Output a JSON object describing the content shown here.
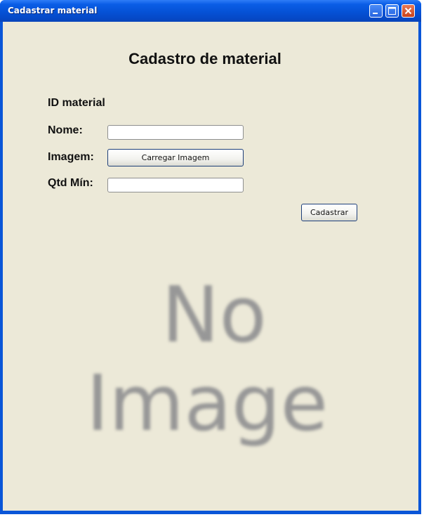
{
  "window": {
    "title": "Cadastrar material",
    "controls": {
      "minimize": "minimize-icon",
      "maximize": "maximize-icon",
      "close": "close-icon"
    }
  },
  "form": {
    "heading": "Cadastro de material",
    "id_label": "ID material",
    "name_label": "Nome:",
    "name_value": "",
    "image_label": "Imagem:",
    "load_image_button": "Carregar Imagem",
    "qty_label": "Qtd Mín:",
    "qty_value": "",
    "submit_button": "Cadastrar"
  },
  "image_placeholder": {
    "line1": "No",
    "line2": "Image"
  },
  "colors": {
    "titlebar": "#0552d6",
    "client_bg": "#ece9d8",
    "placeholder_text": "#979797"
  }
}
